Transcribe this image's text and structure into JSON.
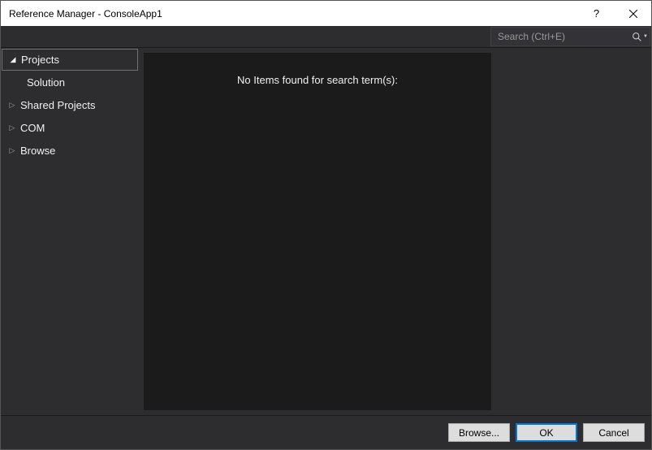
{
  "window": {
    "title": "Reference Manager - ConsoleApp1"
  },
  "search": {
    "placeholder": "Search (Ctrl+E)"
  },
  "sidebar": {
    "items": [
      {
        "label": "Projects",
        "expanded": true
      },
      {
        "label": "Shared Projects",
        "expanded": false
      },
      {
        "label": "COM",
        "expanded": false
      },
      {
        "label": "Browse",
        "expanded": false
      }
    ],
    "subitem": "Solution"
  },
  "main": {
    "empty_message": "No Items found for search term(s):"
  },
  "footer": {
    "browse": "Browse...",
    "ok": "OK",
    "cancel": "Cancel"
  }
}
